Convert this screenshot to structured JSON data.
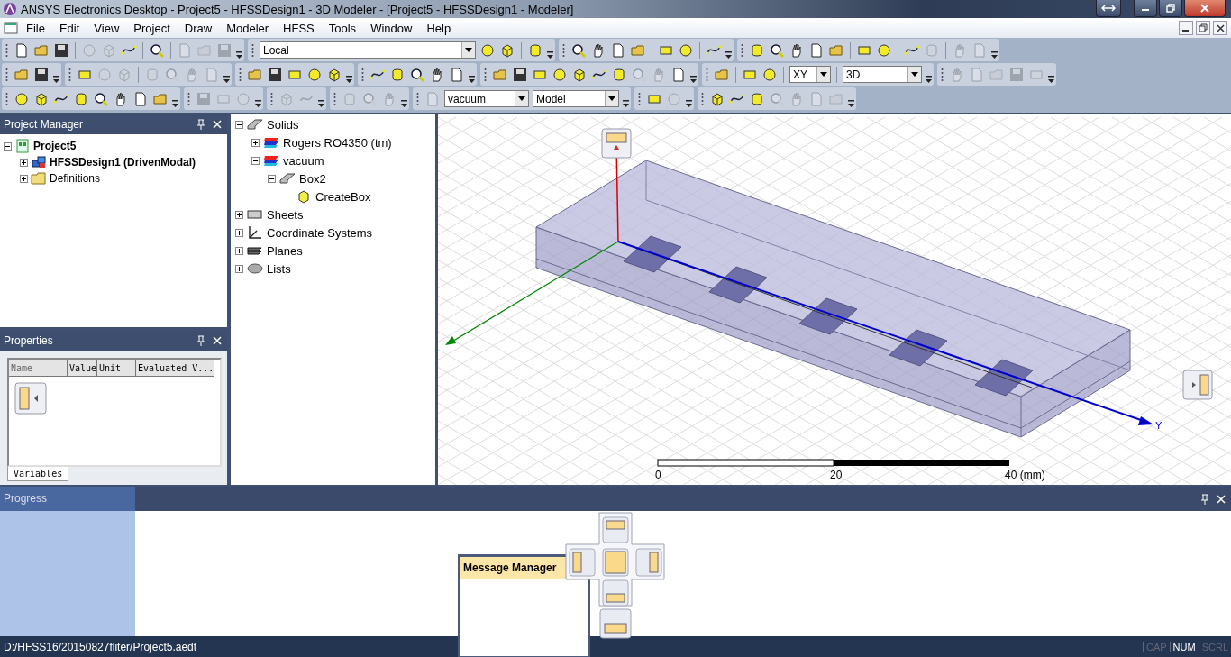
{
  "window": {
    "title": "ANSYS Electronics Desktop - Project5 - HFSSDesign1 - 3D Modeler - [Project5 - HFSSDesign1 - Modeler]"
  },
  "menu": [
    "File",
    "Edit",
    "View",
    "Project",
    "Draw",
    "Modeler",
    "HFSS",
    "Tools",
    "Window",
    "Help"
  ],
  "toolbars": [
    [
      {
        "items": [
          {
            "kind": "icon",
            "disabled": false
          },
          {
            "kind": "icon",
            "disabled": false
          },
          {
            "kind": "icon",
            "disabled": false
          },
          {
            "kind": "sep"
          },
          {
            "kind": "icon",
            "disabled": true
          },
          {
            "kind": "icon",
            "disabled": true
          },
          {
            "kind": "icon",
            "disabled": false
          },
          {
            "kind": "sep"
          },
          {
            "kind": "icon",
            "disabled": false
          },
          {
            "kind": "sep"
          },
          {
            "kind": "icon",
            "disabled": true
          },
          {
            "kind": "icon",
            "disabled": true
          },
          {
            "kind": "icon",
            "disabled": true
          }
        ]
      },
      {
        "items": [
          {
            "kind": "combo",
            "value": "Local"
          },
          {
            "kind": "icon",
            "disabled": false
          },
          {
            "kind": "icon",
            "disabled": false
          },
          {
            "kind": "sep"
          },
          {
            "kind": "icon",
            "disabled": false
          }
        ]
      },
      {
        "items": [
          {
            "kind": "icon",
            "disabled": false
          },
          {
            "kind": "icon",
            "disabled": false
          },
          {
            "kind": "icon",
            "disabled": false
          },
          {
            "kind": "icon",
            "disabled": false
          },
          {
            "kind": "sep"
          },
          {
            "kind": "icon",
            "disabled": false
          },
          {
            "kind": "icon",
            "disabled": false
          },
          {
            "kind": "sep"
          },
          {
            "kind": "icon",
            "disabled": false
          }
        ]
      },
      {
        "items": [
          {
            "kind": "icon",
            "disabled": false
          },
          {
            "kind": "icon",
            "disabled": false
          },
          {
            "kind": "icon",
            "disabled": false
          },
          {
            "kind": "icon",
            "disabled": false
          },
          {
            "kind": "icon",
            "disabled": false
          },
          {
            "kind": "sep"
          },
          {
            "kind": "icon",
            "disabled": false
          },
          {
            "kind": "icon",
            "disabled": false
          },
          {
            "kind": "sep"
          },
          {
            "kind": "icon",
            "disabled": false
          },
          {
            "kind": "icon",
            "disabled": true
          },
          {
            "kind": "sep"
          },
          {
            "kind": "icon",
            "disabled": true
          },
          {
            "kind": "icon",
            "disabled": true
          }
        ]
      }
    ],
    [
      {
        "items": [
          {
            "kind": "icon",
            "disabled": false
          },
          {
            "kind": "icon",
            "disabled": false
          }
        ]
      },
      {
        "items": [
          {
            "kind": "icon",
            "disabled": false
          },
          {
            "kind": "icon",
            "disabled": true
          },
          {
            "kind": "icon",
            "disabled": true
          },
          {
            "kind": "sep"
          },
          {
            "kind": "icon",
            "disabled": true
          },
          {
            "kind": "icon",
            "disabled": true
          },
          {
            "kind": "icon",
            "disabled": true
          },
          {
            "kind": "icon",
            "disabled": true
          }
        ]
      },
      {
        "items": [
          {
            "kind": "icon",
            "disabled": false
          },
          {
            "kind": "icon",
            "disabled": false
          },
          {
            "kind": "icon",
            "disabled": false
          },
          {
            "kind": "icon",
            "disabled": false
          },
          {
            "kind": "icon",
            "disabled": false
          }
        ]
      },
      {
        "items": [
          {
            "kind": "icon",
            "disabled": false
          },
          {
            "kind": "icon",
            "disabled": false
          },
          {
            "kind": "icon",
            "disabled": false
          },
          {
            "kind": "icon",
            "disabled": false
          },
          {
            "kind": "icon",
            "disabled": false
          }
        ]
      },
      {
        "items": [
          {
            "kind": "icon",
            "disabled": false
          },
          {
            "kind": "icon",
            "disabled": false
          },
          {
            "kind": "icon",
            "disabled": false
          },
          {
            "kind": "icon",
            "disabled": false
          },
          {
            "kind": "icon",
            "disabled": false
          },
          {
            "kind": "icon",
            "disabled": false
          },
          {
            "kind": "icon",
            "disabled": false
          },
          {
            "kind": "icon",
            "disabled": true
          },
          {
            "kind": "icon",
            "disabled": true
          },
          {
            "kind": "icon",
            "disabled": false
          }
        ]
      },
      {
        "items": [
          {
            "kind": "icon",
            "disabled": false
          },
          {
            "kind": "sep"
          },
          {
            "kind": "icon",
            "disabled": false
          },
          {
            "kind": "icon",
            "disabled": false
          },
          {
            "kind": "sep"
          },
          {
            "kind": "combo",
            "value": "XY"
          },
          {
            "kind": "sep"
          },
          {
            "kind": "combo",
            "value": "3D"
          }
        ]
      },
      {
        "items": [
          {
            "kind": "icon",
            "disabled": true
          },
          {
            "kind": "icon",
            "disabled": true
          },
          {
            "kind": "icon",
            "disabled": true
          },
          {
            "kind": "icon",
            "disabled": true
          },
          {
            "kind": "icon",
            "disabled": true
          }
        ]
      }
    ],
    [
      {
        "items": [
          {
            "kind": "icon",
            "disabled": false
          },
          {
            "kind": "icon",
            "disabled": false
          },
          {
            "kind": "icon",
            "disabled": false
          },
          {
            "kind": "icon",
            "disabled": false
          },
          {
            "kind": "icon",
            "disabled": false
          },
          {
            "kind": "icon",
            "disabled": false
          },
          {
            "kind": "icon",
            "disabled": false
          },
          {
            "kind": "icon",
            "disabled": false
          }
        ]
      },
      {
        "items": [
          {
            "kind": "icon",
            "disabled": true
          },
          {
            "kind": "icon",
            "disabled": true
          },
          {
            "kind": "icon",
            "disabled": true
          }
        ]
      },
      {
        "items": [
          {
            "kind": "icon",
            "disabled": true
          },
          {
            "kind": "icon",
            "disabled": true
          }
        ]
      },
      {
        "items": [
          {
            "kind": "icon",
            "disabled": true
          },
          {
            "kind": "icon",
            "disabled": true
          },
          {
            "kind": "icon",
            "disabled": true
          }
        ]
      },
      {
        "items": [
          {
            "kind": "icon",
            "disabled": true
          },
          {
            "kind": "combo",
            "value": "vacuum"
          },
          {
            "kind": "combo",
            "value": "Model"
          }
        ]
      },
      {
        "items": [
          {
            "kind": "icon",
            "disabled": false
          },
          {
            "kind": "icon",
            "disabled": true
          }
        ]
      },
      {
        "items": [
          {
            "kind": "icon",
            "disabled": false
          },
          {
            "kind": "icon",
            "disabled": false
          },
          {
            "kind": "icon",
            "disabled": false
          },
          {
            "kind": "icon",
            "disabled": true
          },
          {
            "kind": "icon",
            "disabled": true
          },
          {
            "kind": "icon",
            "disabled": true
          },
          {
            "kind": "icon",
            "disabled": true
          }
        ]
      }
    ]
  ],
  "project_manager": {
    "title": "Project Manager",
    "tree": [
      {
        "label": "Project5",
        "kind": "project",
        "bold": true,
        "expanded": true,
        "children": [
          {
            "label": "HFSSDesign1 (DrivenModal)",
            "kind": "design",
            "bold": true,
            "expanded": false
          },
          {
            "label": "Definitions",
            "kind": "folder",
            "bold": false,
            "expanded": false
          }
        ]
      }
    ]
  },
  "properties": {
    "title": "Properties",
    "columns": [
      "Name",
      "Value",
      "Unit",
      "Evaluated V..."
    ],
    "tabs": [
      {
        "label": "Variables",
        "selected": true
      }
    ]
  },
  "model_tree": [
    {
      "label": "Solids",
      "kind": "group",
      "expanded": true,
      "children": [
        {
          "label": "Rogers RO4350 (tm)",
          "kind": "material",
          "expanded": false
        },
        {
          "label": "vacuum",
          "kind": "material",
          "expanded": true,
          "children": [
            {
              "label": "Box2",
              "kind": "object",
              "expanded": true,
              "children": [
                {
                  "label": "CreateBox",
                  "kind": "operation"
                }
              ]
            }
          ]
        }
      ]
    },
    {
      "label": "Sheets",
      "kind": "sheet",
      "expanded": false
    },
    {
      "label": "Coordinate Systems",
      "kind": "coords",
      "expanded": false
    },
    {
      "label": "Planes",
      "kind": "planes",
      "expanded": false
    },
    {
      "label": "Lists",
      "kind": "lists",
      "expanded": false
    }
  ],
  "viewport": {
    "axis_label": "Y",
    "scale_ticks": [
      "0",
      "20",
      "40 (mm)"
    ]
  },
  "progress": {
    "title": "Progress"
  },
  "message_manager": {
    "title": "Message Manager"
  },
  "status_bar": {
    "path": "D:/HFSS16/20150827fliter/Project5.aedt",
    "indicators": [
      {
        "label": "CAP",
        "on": false
      },
      {
        "label": "NUM",
        "on": true
      },
      {
        "label": "SCRL",
        "on": false
      }
    ]
  }
}
